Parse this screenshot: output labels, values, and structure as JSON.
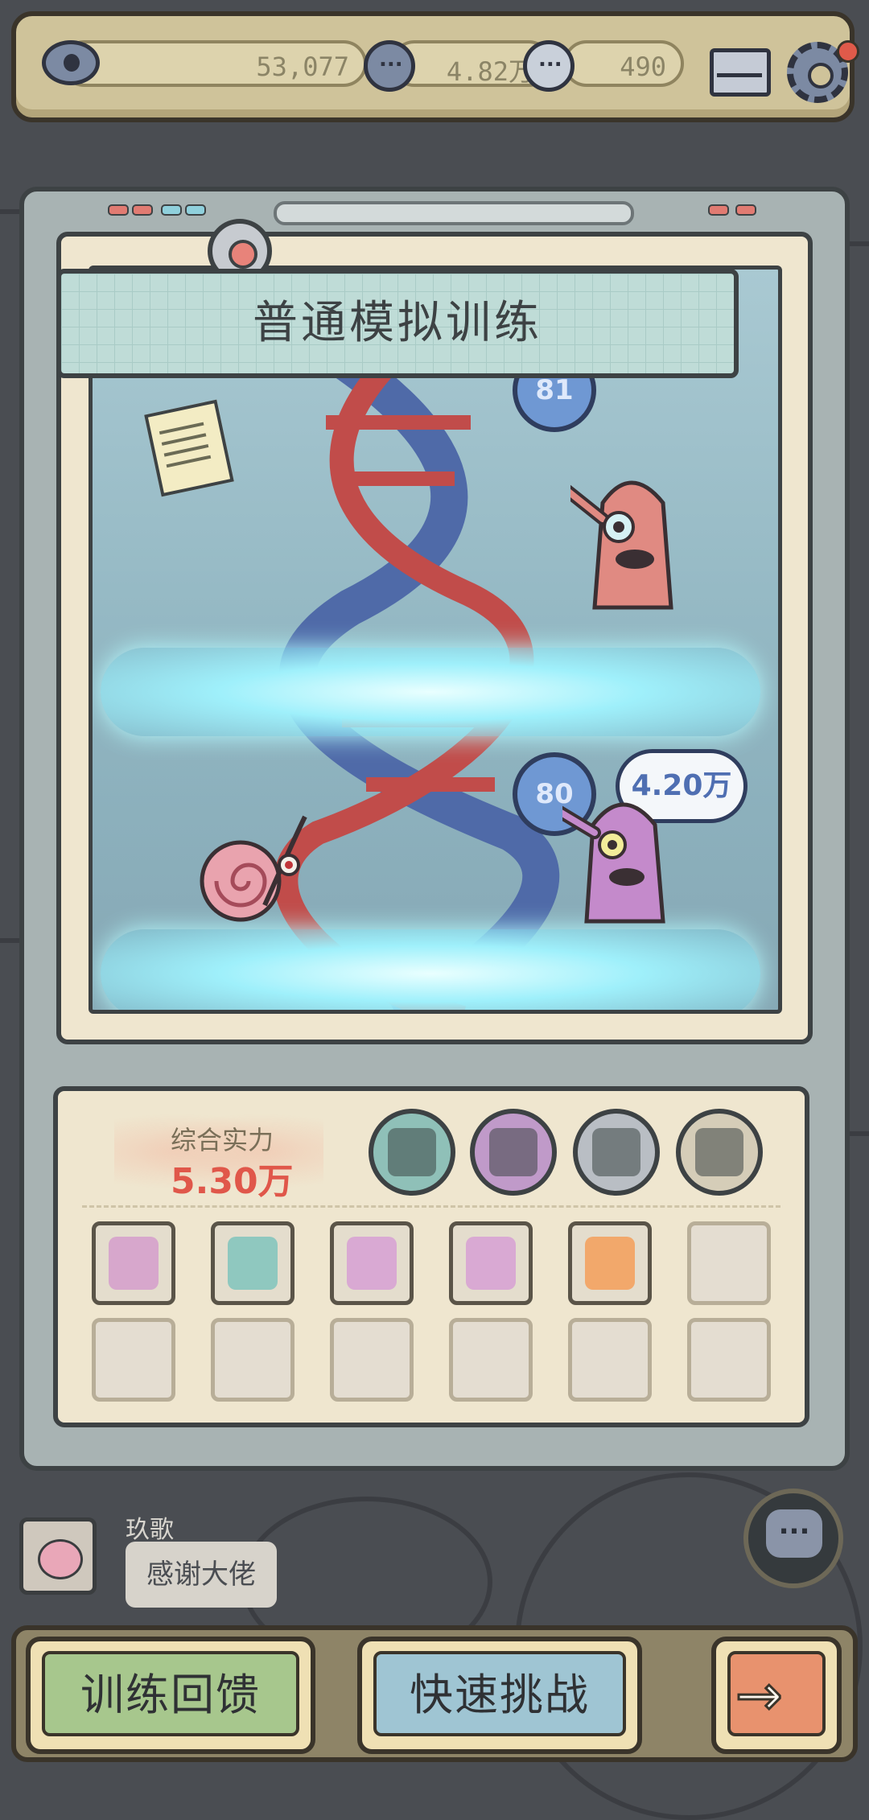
{
  "resources": {
    "views": "53,077",
    "comments": "4.82万",
    "messages": "490"
  },
  "training": {
    "title": "普通模拟训练",
    "levels": [
      {
        "level": "81"
      },
      {
        "level": "80",
        "bubble": "4.20万"
      }
    ]
  },
  "stats": {
    "label": "综合实力",
    "value": "5.30万",
    "skills": [
      {
        "icon": "green-monster-skill-icon",
        "color": "#8fc0b8"
      },
      {
        "icon": "purple-trap-skill-icon",
        "color": "#c09ac9"
      },
      {
        "icon": "grey-chain-skill-icon",
        "color": "#b9bec4"
      },
      {
        "icon": "add-monster-skill-icon",
        "color": "#d5cdb8"
      }
    ],
    "equipment": [
      {
        "icon": "gas-mask-icon",
        "color": "#d7a7cc"
      },
      {
        "icon": "armor-vest-icon",
        "color": "#8fc8bf"
      },
      {
        "icon": "golden-tag-icon",
        "color": "#d9a9d3"
      },
      {
        "icon": "golden-tag-icon",
        "color": "#d9a9d3"
      },
      {
        "icon": "magic-hat-icon",
        "color": "#f2a86b"
      },
      {
        "icon": "empty-slot",
        "color": ""
      },
      {
        "icon": "empty-slot",
        "color": ""
      },
      {
        "icon": "empty-slot",
        "color": ""
      },
      {
        "icon": "empty-slot",
        "color": ""
      },
      {
        "icon": "empty-slot",
        "color": ""
      },
      {
        "icon": "empty-slot",
        "color": ""
      },
      {
        "icon": "empty-slot",
        "color": ""
      }
    ]
  },
  "chat": {
    "user": "玖歌",
    "message": "感谢大佬"
  },
  "buttons": {
    "feedback": "训练回馈",
    "challenge": "快速挑战",
    "next": "→"
  }
}
